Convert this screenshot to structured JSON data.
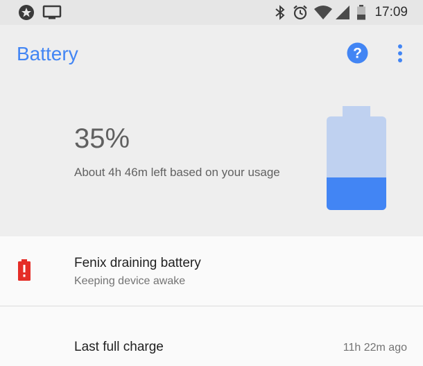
{
  "status_bar": {
    "time": "17:09",
    "left_icons": [
      "star-badge-icon",
      "cast-screen-icon"
    ],
    "right_icons": [
      "bluetooth-icon",
      "alarm-icon",
      "wifi-icon",
      "cell-signal-icon",
      "battery-status-icon"
    ]
  },
  "header": {
    "title": "Battery",
    "accent_color": "#4285f4"
  },
  "battery": {
    "percent_label": "35%",
    "level_fraction": 0.35,
    "remaining_text": "About 4h 46m left based on your usage",
    "fill_color": "#4285f4",
    "empty_color": "#bfd1f0"
  },
  "drain_alert": {
    "title": "Fenix draining battery",
    "subtitle": "Keeping device awake",
    "icon": "battery-alert-icon",
    "icon_color": "#e52d27"
  },
  "last_charge": {
    "label": "Last full charge",
    "value": "11h 22m ago"
  }
}
